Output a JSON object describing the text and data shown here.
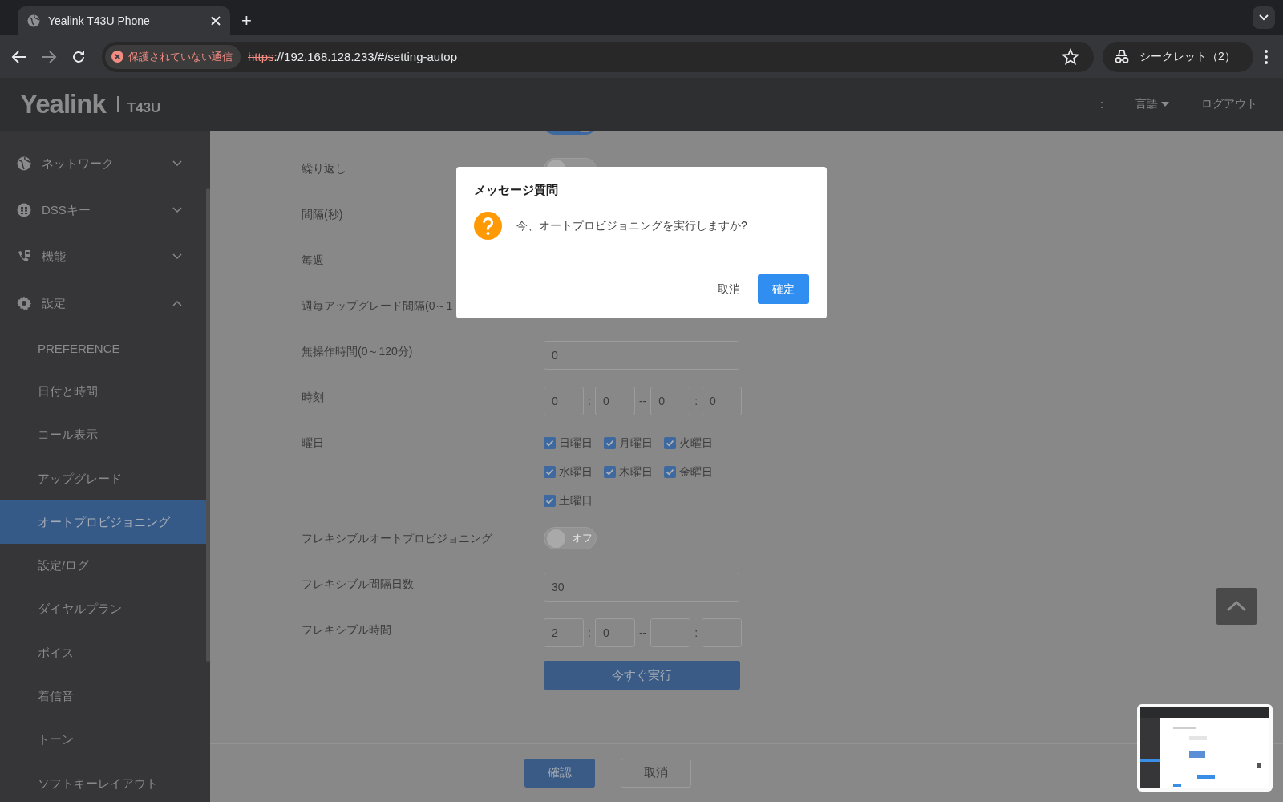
{
  "browser": {
    "tab": {
      "title": "Yealink T43U Phone",
      "selected": true
    },
    "new_tab": "+",
    "address": {
      "security": "保護されていない通信",
      "scheme": "https",
      "rest": "://192.168.128.233/#/setting-autop"
    },
    "profile": "シークレット（2）"
  },
  "header": {
    "logo": "Yealink",
    "model": "T43U",
    "separator": ":",
    "language": "言語",
    "logout": "ログアウト"
  },
  "sidebar": {
    "items": [
      {
        "label": "ネットワーク",
        "expanded": false
      },
      {
        "label": "DSSキー",
        "expanded": false
      },
      {
        "label": "機能",
        "expanded": false
      },
      {
        "label": "設定",
        "expanded": true,
        "children": [
          {
            "label": "PREFERENCE",
            "selected": false
          },
          {
            "label": "日付と時間",
            "selected": false
          },
          {
            "label": "コール表示",
            "selected": false
          },
          {
            "label": "アップグレード",
            "selected": false
          },
          {
            "label": "オートプロビジョニング",
            "selected": true
          },
          {
            "label": "設定/ログ",
            "selected": false
          },
          {
            "label": "ダイヤルプラン",
            "selected": false
          },
          {
            "label": "ボイス",
            "selected": false
          },
          {
            "label": "着信音",
            "selected": false
          },
          {
            "label": "トーン",
            "selected": false
          },
          {
            "label": "ソフトキーレイアウト",
            "selected": false
          }
        ]
      }
    ]
  },
  "form": {
    "rows": [
      {
        "kind": "toggle",
        "on": true
      },
      {
        "kind": "toggle",
        "label": "繰り返し",
        "on": false
      },
      {
        "kind": "label",
        "label": "間隔(秒)"
      },
      {
        "kind": "label",
        "label": "毎週"
      },
      {
        "kind": "label",
        "label": "週毎アップグレード間隔(0～1"
      },
      {
        "kind": "text",
        "label": "無操作時間(0～120分)",
        "value": "0"
      },
      {
        "kind": "time",
        "label": "時刻",
        "values": [
          "0",
          "0",
          "0",
          "0"
        ],
        "separators": [
          ":",
          "--",
          ":"
        ]
      },
      {
        "kind": "checkboxes",
        "label": "曜日",
        "options": [
          {
            "label": "日曜日",
            "checked": true
          },
          {
            "label": "月曜日",
            "checked": true
          },
          {
            "label": "火曜日",
            "checked": true
          },
          {
            "label": "水曜日",
            "checked": true
          },
          {
            "label": "木曜日",
            "checked": true
          },
          {
            "label": "金曜日",
            "checked": true
          },
          {
            "label": "土曜日",
            "checked": true
          }
        ]
      },
      {
        "kind": "toggle",
        "label": "フレキシブルオートプロビジョニング",
        "on": false,
        "state_label": "オフ"
      },
      {
        "kind": "text",
        "label": "フレキシブル間隔日数",
        "value": "30"
      },
      {
        "kind": "time",
        "label": "フレキシブル時間",
        "fields": [
          {
            "kind": "filled",
            "value": "2"
          },
          {
            "kind": "filled",
            "value": "0"
          },
          {
            "kind": "blank"
          },
          {
            "kind": "blank"
          }
        ],
        "separators": [
          ":",
          "--",
          ":"
        ]
      },
      {
        "kind": "button",
        "label": "今すぐ実行"
      }
    ]
  },
  "footer": {
    "buttons": [
      {
        "label": "確認",
        "kind": "primary"
      },
      {
        "label": "取消",
        "kind": "default"
      }
    ]
  },
  "dialog": {
    "title": "メッセージ質問",
    "message": "今、オートプロビジョニングを実行しますか?",
    "buttons": [
      {
        "label": "取消",
        "kind": "text"
      },
      {
        "label": "確定",
        "kind": "primary"
      }
    ]
  }
}
